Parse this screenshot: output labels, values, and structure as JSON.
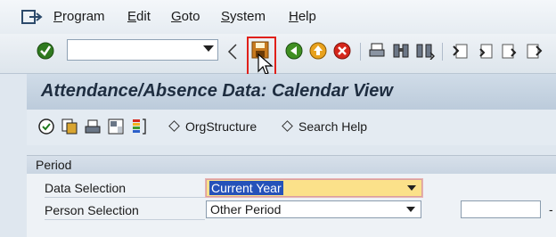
{
  "menubar": {
    "items": [
      {
        "label": "Program",
        "accel": "P"
      },
      {
        "label": "Edit",
        "accel": "E"
      },
      {
        "label": "Goto",
        "accel": "G"
      },
      {
        "label": "System",
        "accel": "S"
      },
      {
        "label": "Help",
        "accel": "H"
      }
    ],
    "icon": "exit-menu-icon"
  },
  "toolbar": {
    "command_field_value": "",
    "icons": [
      "enter-icon",
      "back-arrow-icon",
      "save-icon",
      "back-icon",
      "exit-icon",
      "cancel-icon",
      "print-icon",
      "find-icon",
      "find-next-icon",
      "first-page-icon",
      "previous-page-icon",
      "next-page-icon",
      "last-page-icon"
    ],
    "highlight_color": "#e0201a"
  },
  "title": "Attendance/Absence Data: Calendar View",
  "app_toolbar": {
    "icons": [
      "execute-icon",
      "copy-icon",
      "print-icon",
      "layout-icon",
      "color-legend-icon"
    ],
    "orgstructure_label": "OrgStructure",
    "search_help_label": "Search Help"
  },
  "period": {
    "title": "Period",
    "data_selection_label": "Data Selection",
    "data_selection_value": "Current Year",
    "person_selection_label": "Person Selection",
    "person_selection_value": "Other Period",
    "from_value": "",
    "dash": "-"
  }
}
